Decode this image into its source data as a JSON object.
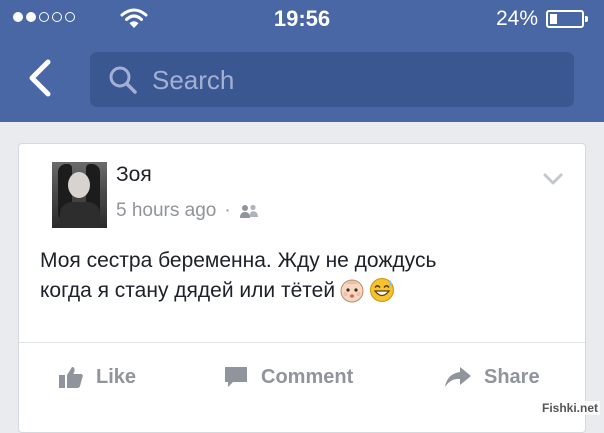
{
  "status_bar": {
    "signal_dots_filled": 2,
    "signal_dots_total": 5,
    "time": "19:56",
    "battery_percent_text": "24%",
    "battery_level": 0.24
  },
  "header": {
    "back_icon": "chevron-left-icon",
    "search": {
      "placeholder": "Search",
      "icon": "search-icon"
    },
    "color": "#4867a4"
  },
  "post": {
    "author": "Зоя",
    "timestamp": "5 hours ago",
    "separator": "·",
    "audience_icon": "friends-icon",
    "text_line1": "Моя сестра беременна. Жду не дождусь",
    "text_line2": "когда я стану дядей или тётей",
    "emojis": [
      "baby-face-emoji",
      "grinning-sweat-emoji"
    ],
    "menu_icon": "chevron-down-icon"
  },
  "actions": {
    "like": "Like",
    "comment": "Comment",
    "share": "Share"
  },
  "watermark": "Fishki.net"
}
